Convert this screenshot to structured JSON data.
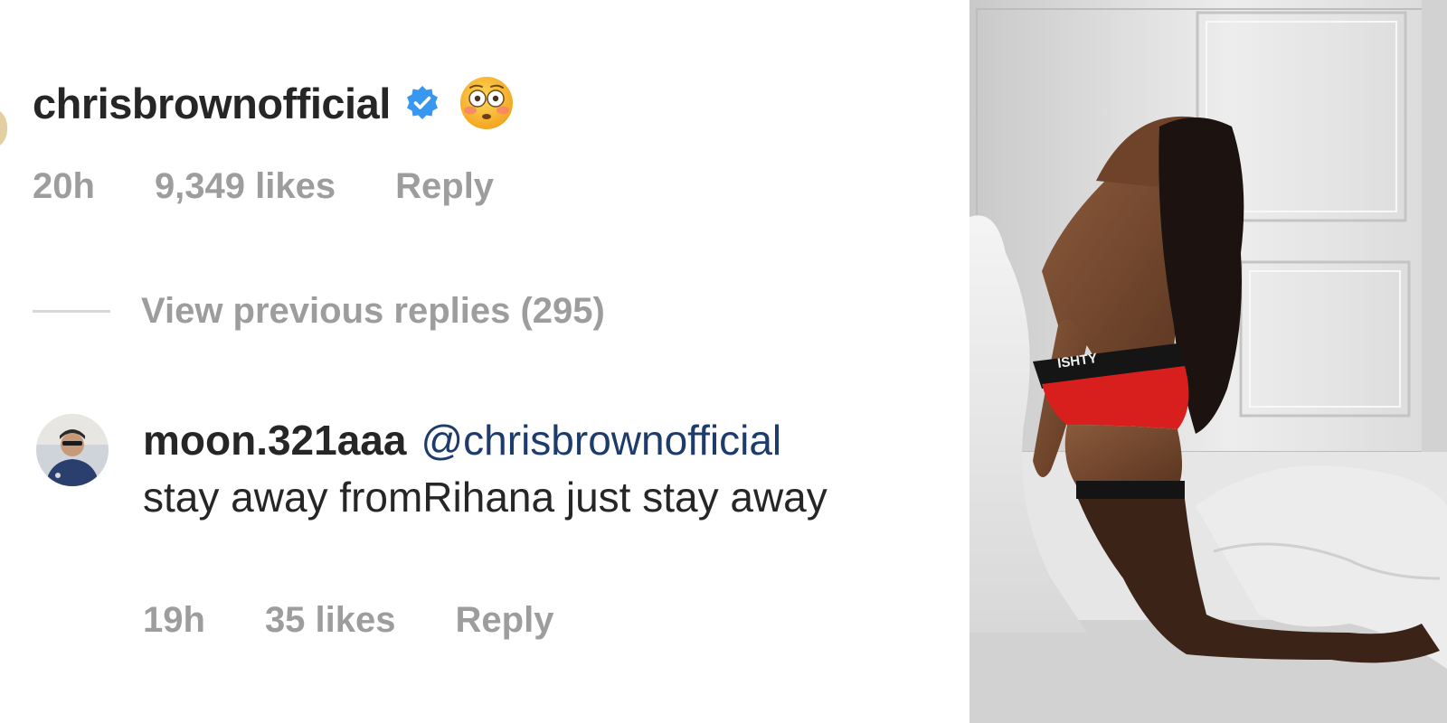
{
  "comment": {
    "username": "chrisbrownofficial",
    "verified_icon": "verified-badge-icon",
    "emoji": "flushed-face-emoji",
    "time": "20h",
    "likes": "9,349 likes",
    "reply_label": "Reply"
  },
  "view_replies": {
    "label": "View previous replies (295)"
  },
  "reply": {
    "username": "moon.321aaa",
    "mention": "@chrisbrownofficial",
    "text": "stay away fromRihana just stay away",
    "time": "19h",
    "likes": "35 likes",
    "reply_label": "Reply"
  },
  "colors": {
    "text_primary": "#262626",
    "text_secondary": "#9d9d9d",
    "mention": "#1d3b6b",
    "verified": "#3897f0"
  }
}
